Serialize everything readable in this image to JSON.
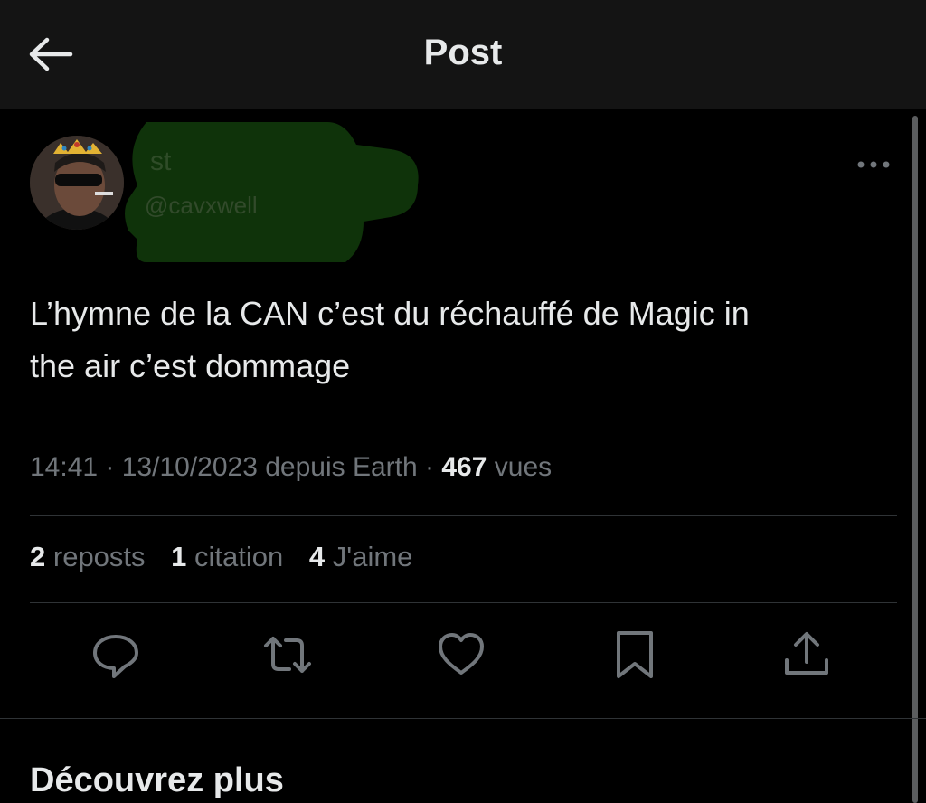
{
  "header": {
    "title": "Post"
  },
  "author": {
    "display_name": "st",
    "handle": "@cavxwell"
  },
  "post": {
    "text_line1": "L’hymne de la CAN c’est du réchauffé de Magic in",
    "text_line2": "the air c’est dommage",
    "time": "14:41",
    "date": "13/10/2023",
    "source": "depuis Earth",
    "views_count": "467",
    "views_label": "vues"
  },
  "stats": {
    "reposts_count": "2",
    "reposts_label": "reposts",
    "quotes_count": "1",
    "quotes_label": "citation",
    "likes_count": "4",
    "likes_label": "J'aime"
  },
  "actions": [
    "reply-icon",
    "repost-icon",
    "like-icon",
    "bookmark-icon",
    "share-icon"
  ],
  "discover": {
    "title": "Découvrez plus"
  },
  "colors": {
    "background": "#000000",
    "header": "#141414",
    "text": "#e7e9ea",
    "muted": "#71767b",
    "divider": "#2f3336",
    "redaction": "#1b5d12"
  }
}
